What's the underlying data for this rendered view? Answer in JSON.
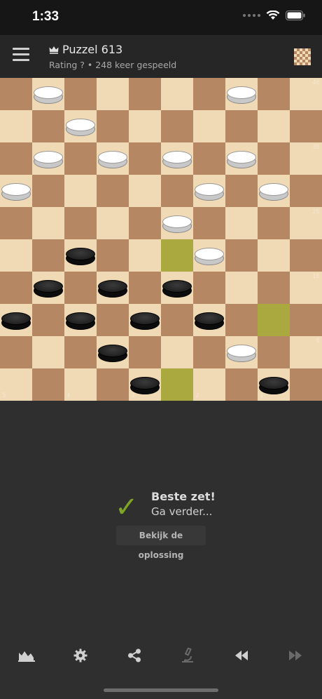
{
  "status": {
    "time": "1:33"
  },
  "header": {
    "title": "Puzzel 613",
    "subtitle": "Rating ? • 248 keer gespeeld"
  },
  "board": {
    "size": 10,
    "light_color": "#f0d9b5",
    "dark_color": "#b58863",
    "highlight_color": "#a9a93f",
    "highlights": [
      [
        6,
        6
      ],
      [
        8,
        9
      ],
      [
        10,
        6
      ]
    ],
    "row_labels": [
      {
        "row": 1,
        "col": 10,
        "text": "46"
      },
      {
        "row": 3,
        "col": 10,
        "text": "36"
      },
      {
        "row": 5,
        "col": 10,
        "text": "26"
      },
      {
        "row": 7,
        "col": 10,
        "text": "16"
      },
      {
        "row": 9,
        "col": 10,
        "text": "6"
      }
    ],
    "col_labels": [
      {
        "row": 10,
        "col": 1,
        "text": "5"
      },
      {
        "row": 10,
        "col": 3,
        "text": "4"
      },
      {
        "row": 10,
        "col": 5,
        "text": "3"
      },
      {
        "row": 10,
        "col": 7,
        "text": "2"
      },
      {
        "row": 10,
        "col": 9,
        "text": "1"
      }
    ],
    "white_pieces": [
      [
        1,
        2
      ],
      [
        1,
        8
      ],
      [
        2,
        3
      ],
      [
        3,
        2
      ],
      [
        3,
        4
      ],
      [
        3,
        6
      ],
      [
        3,
        8
      ],
      [
        4,
        1
      ],
      [
        4,
        7
      ],
      [
        4,
        9
      ],
      [
        5,
        6
      ],
      [
        6,
        7
      ],
      [
        9,
        8
      ]
    ],
    "black_pieces": [
      [
        6,
        3
      ],
      [
        7,
        2
      ],
      [
        7,
        4
      ],
      [
        7,
        6
      ],
      [
        8,
        1
      ],
      [
        8,
        3
      ],
      [
        8,
        5
      ],
      [
        8,
        7
      ],
      [
        9,
        4
      ],
      [
        10,
        5
      ],
      [
        10,
        9
      ]
    ]
  },
  "feedback": {
    "check": "✓",
    "title": "Beste zet!",
    "subtitle": "Ga verder..."
  },
  "solution_button": "Bekijk de oplossing",
  "toolbar": {
    "icons": [
      "chart-icon",
      "gear-icon",
      "share-icon",
      "microscope-icon",
      "rewind-icon",
      "forward-icon"
    ],
    "active_color": "#d0d0d0",
    "disabled_color": "#6a6a6a"
  }
}
